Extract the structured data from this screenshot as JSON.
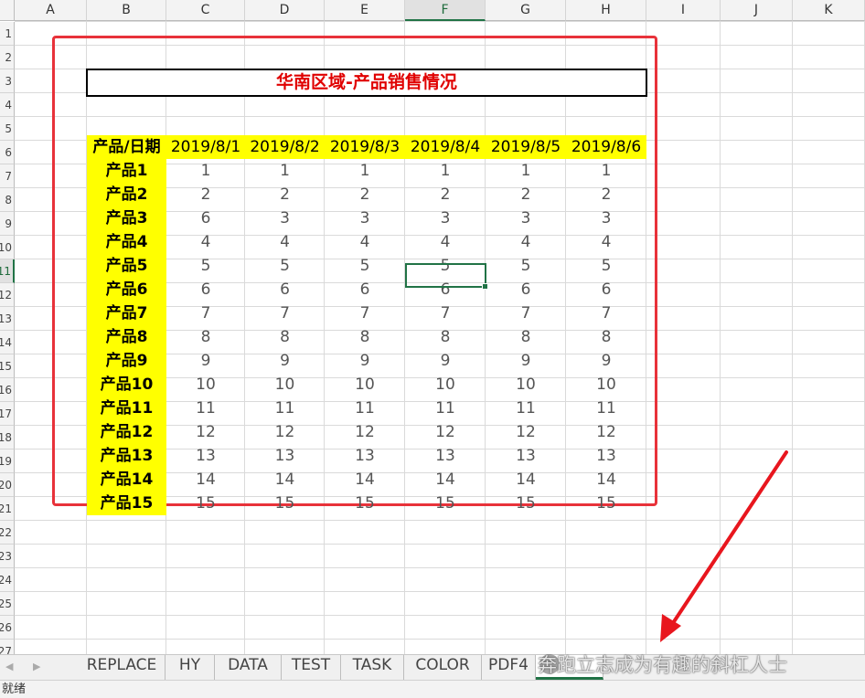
{
  "columns": [
    "A",
    "B",
    "C",
    "D",
    "E",
    "F",
    "G",
    "H",
    "I",
    "J",
    "K"
  ],
  "selected_column": "F",
  "row_labels": [
    "1",
    "2",
    "3",
    "4",
    "5",
    "6",
    "7",
    "8",
    "9",
    "10",
    "11",
    "12",
    "13",
    "14",
    "15",
    "16",
    "17",
    "18",
    "19",
    "20",
    "21",
    "22",
    "23",
    "24",
    "25",
    "26",
    "27"
  ],
  "selected_row": "11",
  "report": {
    "title": "华南区域-产品销售情况",
    "header_label": "产品/日期",
    "dates": [
      "2019/8/1",
      "2019/8/2",
      "2019/8/3",
      "2019/8/4",
      "2019/8/5",
      "2019/8/6"
    ],
    "rows": [
      {
        "product": "产品1",
        "values": [
          "1",
          "1",
          "1",
          "1",
          "1",
          "1"
        ]
      },
      {
        "product": "产品2",
        "values": [
          "2",
          "2",
          "2",
          "2",
          "2",
          "2"
        ]
      },
      {
        "product": "产品3",
        "values": [
          "6",
          "3",
          "3",
          "3",
          "3",
          "3"
        ]
      },
      {
        "product": "产品4",
        "values": [
          "4",
          "4",
          "4",
          "4",
          "4",
          "4"
        ]
      },
      {
        "product": "产品5",
        "values": [
          "5",
          "5",
          "5",
          "5",
          "5",
          "5"
        ]
      },
      {
        "product": "产品6",
        "values": [
          "6",
          "6",
          "6",
          "6",
          "6",
          "6"
        ]
      },
      {
        "product": "产品7",
        "values": [
          "7",
          "7",
          "7",
          "7",
          "7",
          "7"
        ]
      },
      {
        "product": "产品8",
        "values": [
          "8",
          "8",
          "8",
          "8",
          "8",
          "8"
        ]
      },
      {
        "product": "产品9",
        "values": [
          "9",
          "9",
          "9",
          "9",
          "9",
          "9"
        ]
      },
      {
        "product": "产品10",
        "values": [
          "10",
          "10",
          "10",
          "10",
          "10",
          "10"
        ]
      },
      {
        "product": "产品11",
        "values": [
          "11",
          "11",
          "11",
          "11",
          "11",
          "11"
        ]
      },
      {
        "product": "产品12",
        "values": [
          "12",
          "12",
          "12",
          "12",
          "12",
          "12"
        ]
      },
      {
        "product": "产品13",
        "values": [
          "13",
          "13",
          "13",
          "13",
          "13",
          "13"
        ]
      },
      {
        "product": "产品14",
        "values": [
          "14",
          "14",
          "14",
          "14",
          "14",
          "14"
        ]
      },
      {
        "product": "产品15",
        "values": [
          "15",
          "15",
          "15",
          "15",
          "15",
          "15"
        ]
      }
    ]
  },
  "tabs": [
    {
      "label": "REPLACE"
    },
    {
      "label": "HY"
    },
    {
      "label": "DATA"
    },
    {
      "label": "TEST"
    },
    {
      "label": "TASK"
    },
    {
      "label": "COLOR"
    },
    {
      "label": "PDF4"
    },
    {
      "label": ""
    }
  ],
  "watermark_text": "奔跑立志成为有趣的斜杠人士",
  "status_text": "就绪",
  "colors": {
    "highlight_yellow": "#ffff00",
    "title_red": "#e00000",
    "frame_red": "#e8323a",
    "excel_green": "#217346"
  }
}
